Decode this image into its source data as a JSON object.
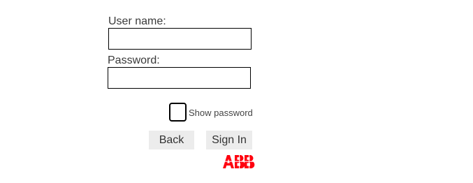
{
  "form": {
    "username_label": "User name:",
    "username_value": "",
    "password_label": "Password:",
    "password_value": "",
    "show_password_label": "Show password",
    "show_password_checked": false,
    "back_label": "Back",
    "signin_label": "Sign In"
  },
  "brand": {
    "logo_text": "ABB",
    "logo_color": "#ff000f"
  }
}
